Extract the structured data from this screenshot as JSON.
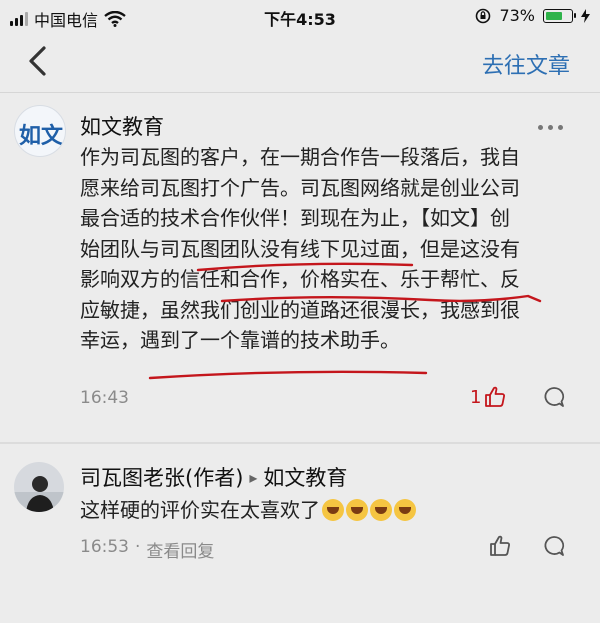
{
  "status_bar": {
    "carrier": "中国电信",
    "time": "下午4:53",
    "battery_percent": "73%",
    "battery_level": 0.73
  },
  "nav": {
    "back_icon": "chevron-left-icon",
    "action": "去往文章"
  },
  "comment": {
    "avatar_text": "如文",
    "author": "如文教育",
    "lines": [
      "作为司瓦图的客户，在一期合作告一段落后，我自",
      "愿来给司瓦图打个广告。司瓦图网络就是创业公司",
      "最合适的技术合作伙伴！到现在为止，【如文】创",
      "始团队与司瓦图团队没有线下见过面，但是这没有",
      "影响双方的信任和合作，价格实在、乐于帮忙、反",
      "应敏捷，虽然我们创业的道路还很漫长，我感到很",
      "幸运，遇到了一个靠谱的技术助手。"
    ],
    "time": "16:43",
    "likes": "1",
    "underline_color": "#c4161c"
  },
  "reply": {
    "author": "司瓦图老张(作者)",
    "arrow": "▸",
    "to": "如文教育",
    "text": "这样硬的评价实在太喜欢了",
    "emojis": [
      "grin-emoji",
      "laugh-emoji",
      "laugh-emoji",
      "laugh-emoji"
    ],
    "time": "16:53",
    "separator": "·",
    "view_reply": "查看回复"
  },
  "colors": {
    "accent": "#2d6fb3",
    "background": "#ececec",
    "like": "#c4161c"
  }
}
